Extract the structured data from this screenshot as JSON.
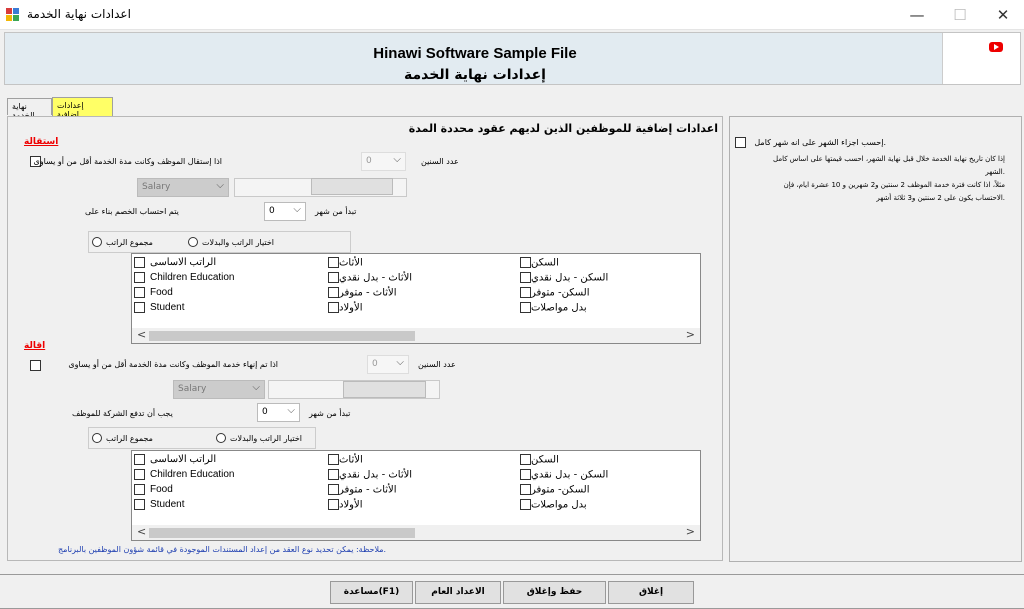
{
  "window": {
    "title": "اعدادات نهاية الخدمة",
    "minimize": "—",
    "maximize": "☐",
    "close": "✕"
  },
  "header": {
    "app_name": "Hinawi Software Sample File",
    "form_title": "إعدادات نهاية الخدمة"
  },
  "tabs": [
    {
      "label": "نهاية الخدمة",
      "active": false
    },
    {
      "label": "إعدادات إضافية",
      "active": true
    }
  ],
  "left": {
    "heading": "اعدادات إضافية للموظفين الذين لديهم عقود محددة المدة",
    "resignation": {
      "label": "استقالة",
      "condition": "اذا إستقال الموظف وكانت مدة الخدمة أقل من أو يساوى",
      "years_label": "عدد السنين",
      "years_value": "0",
      "salary_value": "Salary",
      "start_label": "تبدأ من شهر",
      "start_value": "0",
      "calc_label": "يتم احتساب الخصم بناء على",
      "radio_total": "مجموع الراتب",
      "radio_select": "اختيار الراتب والبدلات"
    },
    "dismissal": {
      "label": "اقالة",
      "condition": "اذا تم إنهاء خدمة الموظف وكانت مدة الخدمة أقل من أو يساوى",
      "years_label": "عدد السنين",
      "years_value": "0",
      "salary_value": "Salary",
      "start_label": "تبدأ من شهر",
      "start_value": "0",
      "calc_label": "يجب أن تدفع الشركة للموظف",
      "radio_total": "مجموع الراتب",
      "radio_select": "اختيار الراتب والبدلات"
    },
    "allowances": {
      "col1": [
        "السكن",
        "السكن - بدل نقدي",
        "السكن- متوفر",
        "بدل مواصلات"
      ],
      "col2": [
        "الأثاث",
        "الأثاث - بدل نقدي",
        "الأثاث - متوفر",
        "الأولاد"
      ],
      "col3": [
        "الراتب الاساسى",
        "Children Education",
        "Food",
        "Student"
      ]
    },
    "scroll_left": "<",
    "scroll_right": ">",
    "note": "ملاحظة: يمكن تحديد نوع العقد من إعداد المستندات الموجودة في قائمة شؤون الموظفين بالبرنامج."
  },
  "right": {
    "checkbox_label": "إحسب اجزاء الشهر على انه شهر كامل.",
    "lines": [
      "إذا كان تاريخ نهاية الخدمة خلال قبل نهاية الشهر، احسب قيمتها على اساس كامل",
      "الشهر.",
      "مثلاً، اذا كانت فترة خدمة الموظف 2 سنتين و2 شهرين و 10 عشرة ايام، فإن",
      "الاحتساب يكون على 2 سنتين و3 ثلاثة أشهر."
    ]
  },
  "buttons": {
    "close": "إغلاق",
    "save_close": "حفظ وإغلاق",
    "general_settings": "الاعداد العام",
    "help": "مساعدة(F1)"
  }
}
